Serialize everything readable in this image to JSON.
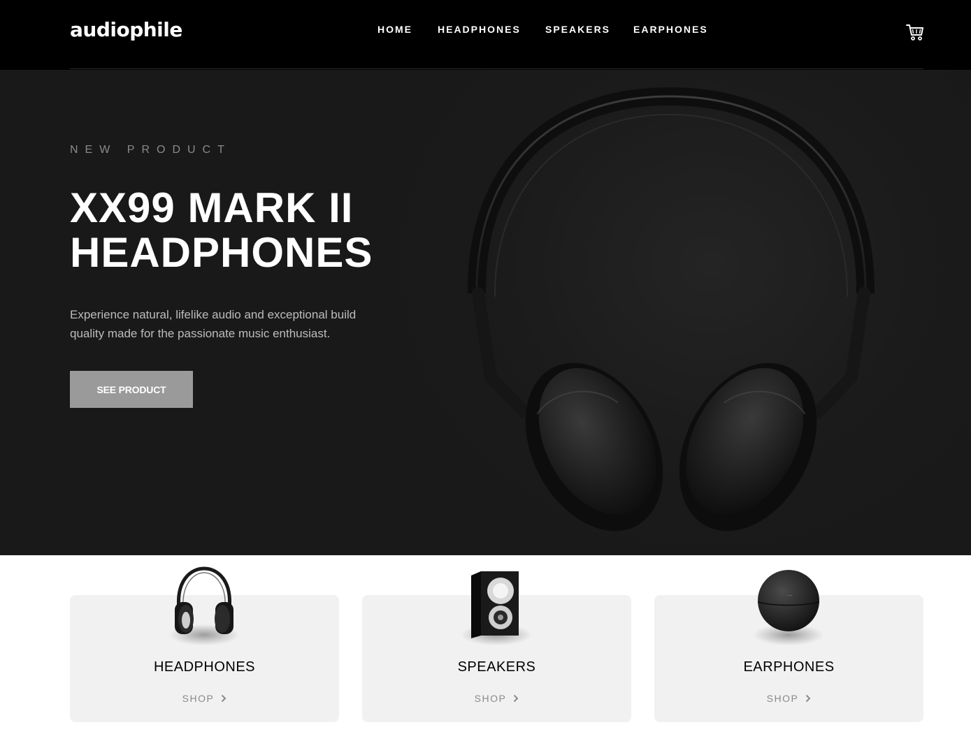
{
  "header": {
    "logo": "audiophile",
    "nav": [
      "HOME",
      "HEADPHONES",
      "SPEAKERS",
      "EARPHONES"
    ],
    "cart_icon": "cart-icon"
  },
  "hero": {
    "overline": "NEW PRODUCT",
    "title_line1": "XX99 MARK II",
    "title_line2": "HEADPHONES",
    "description": "Experience natural, lifelike audio and exceptional build quality made for the passionate music enthusiast.",
    "button": "SEE PRODUCT"
  },
  "categories": [
    {
      "title": "HEADPHONES",
      "shop": "SHOP"
    },
    {
      "title": "SPEAKERS",
      "shop": "SHOP"
    },
    {
      "title": "EARPHONES",
      "shop": "SHOP"
    }
  ],
  "colors": {
    "header_bg": "#000000",
    "hero_bg": "#191919",
    "button_bg": "#9a9a9a",
    "card_bg": "#f1f1f1"
  }
}
